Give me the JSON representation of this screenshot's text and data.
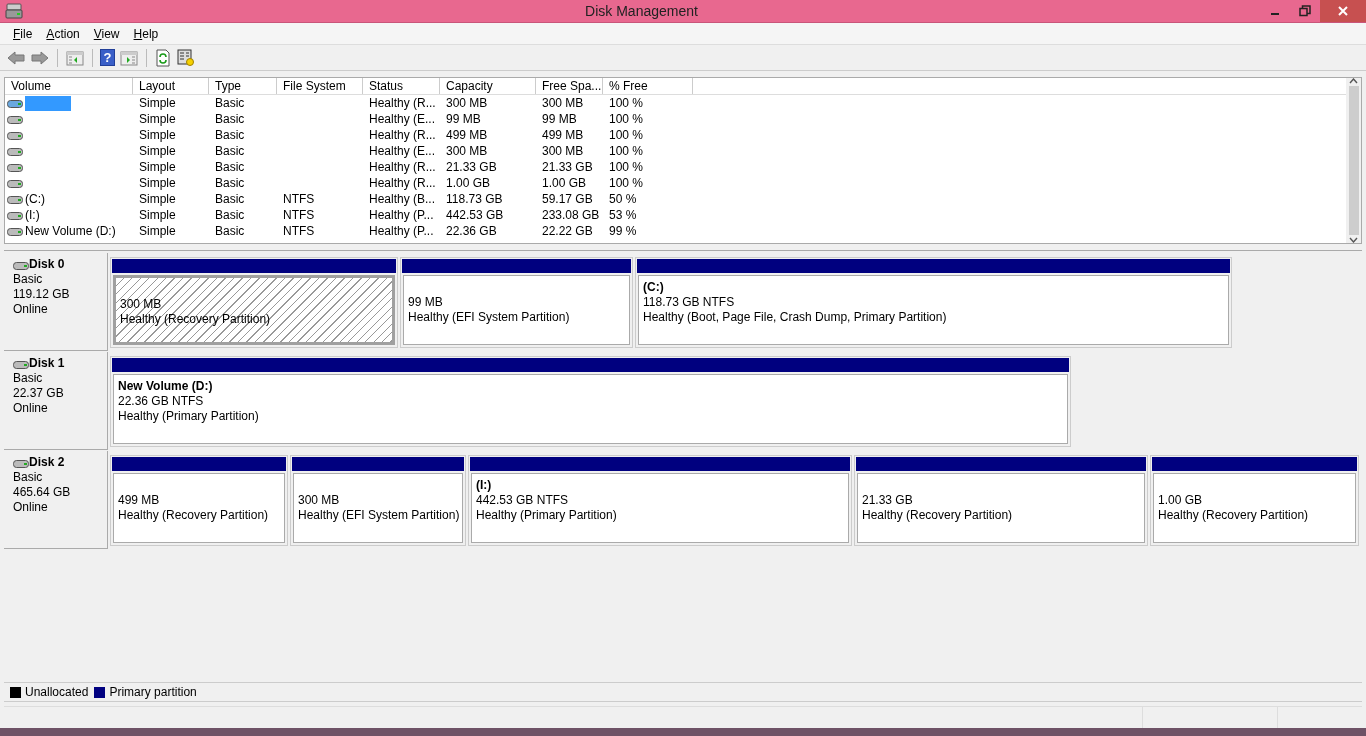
{
  "window": {
    "title": "Disk Management"
  },
  "menu": [
    "File",
    "Action",
    "View",
    "Help"
  ],
  "toolbar": {
    "help_glyph": "?"
  },
  "volume_list": {
    "columns": [
      "Volume",
      "Layout",
      "Type",
      "File System",
      "Status",
      "Capacity",
      "Free Spa...",
      "% Free"
    ],
    "rows": [
      {
        "layout": "Simple",
        "type": "Basic",
        "status": "Healthy (R...",
        "capacity": "300 MB",
        "free_space": "300 MB",
        "percent_free": "100 %",
        "selected": true
      },
      {
        "layout": "Simple",
        "type": "Basic",
        "status": "Healthy (E...",
        "capacity": "99 MB",
        "free_space": "99 MB",
        "percent_free": "100 %",
        "selected": false
      },
      {
        "layout": "Simple",
        "type": "Basic",
        "status": "Healthy (R...",
        "capacity": "499 MB",
        "free_space": "499 MB",
        "percent_free": "100 %",
        "selected": false
      },
      {
        "layout": "Simple",
        "type": "Basic",
        "status": "Healthy (E...",
        "capacity": "300 MB",
        "free_space": "300 MB",
        "percent_free": "100 %",
        "selected": false
      },
      {
        "layout": "Simple",
        "type": "Basic",
        "status": "Healthy (R...",
        "capacity": "21.33 GB",
        "free_space": "21.33 GB",
        "percent_free": "100 %",
        "selected": false
      },
      {
        "layout": "Simple",
        "type": "Basic",
        "status": "Healthy (R...",
        "capacity": "1.00 GB",
        "free_space": "1.00 GB",
        "percent_free": "100 %",
        "selected": false
      },
      {
        "volume": "(C:)",
        "layout": "Simple",
        "type": "Basic",
        "file_system": "NTFS",
        "status": "Healthy (B...",
        "capacity": "118.73 GB",
        "free_space": "59.17 GB",
        "percent_free": "50 %",
        "selected": false
      },
      {
        "volume": "(I:)",
        "layout": "Simple",
        "type": "Basic",
        "file_system": "NTFS",
        "status": "Healthy (P...",
        "capacity": "442.53 GB",
        "free_space": "233.08 GB",
        "percent_free": "53 %",
        "selected": false
      },
      {
        "volume": "New Volume (D:)",
        "layout": "Simple",
        "type": "Basic",
        "file_system": "NTFS",
        "status": "Healthy (P...",
        "capacity": "22.36 GB",
        "free_space": "22.22 GB",
        "percent_free": "99 %",
        "selected": false
      }
    ]
  },
  "disks": [
    {
      "name": "Disk 0",
      "type": "Basic",
      "size": "119.12 GB",
      "state": "Online",
      "partitions": [
        {
          "size": "300 MB",
          "status": "Healthy (Recovery Partition)",
          "selected": true
        },
        {
          "size": "99 MB",
          "status": "Healthy (EFI System Partition)",
          "selected": false
        },
        {
          "label": "(C:)",
          "size": "118.73 GB NTFS",
          "status": "Healthy (Boot, Page File, Crash Dump, Primary Partition)",
          "selected": false
        }
      ]
    },
    {
      "name": "Disk 1",
      "type": "Basic",
      "size": "22.37 GB",
      "state": "Online",
      "partitions": [
        {
          "label": "New Volume  (D:)",
          "size": "22.36 GB NTFS",
          "status": "Healthy (Primary Partition)",
          "selected": false
        }
      ]
    },
    {
      "name": "Disk 2",
      "type": "Basic",
      "size": "465.64 GB",
      "state": "Online",
      "partitions": [
        {
          "size": "499 MB",
          "status": "Healthy (Recovery Partition)",
          "selected": false
        },
        {
          "size": "300 MB",
          "status": "Healthy (EFI System Partition)",
          "selected": false
        },
        {
          "label": "(I:)",
          "size": "442.53 GB NTFS",
          "status": "Healthy (Primary Partition)",
          "selected": false
        },
        {
          "size": "21.33 GB",
          "status": "Healthy (Recovery Partition)",
          "selected": false
        },
        {
          "size": "1.00 GB",
          "status": "Healthy (Recovery Partition)",
          "selected": false
        }
      ]
    }
  ],
  "legend": [
    {
      "label": "Unallocated",
      "color": "#000000"
    },
    {
      "label": "Primary partition",
      "color": "#000080"
    }
  ]
}
